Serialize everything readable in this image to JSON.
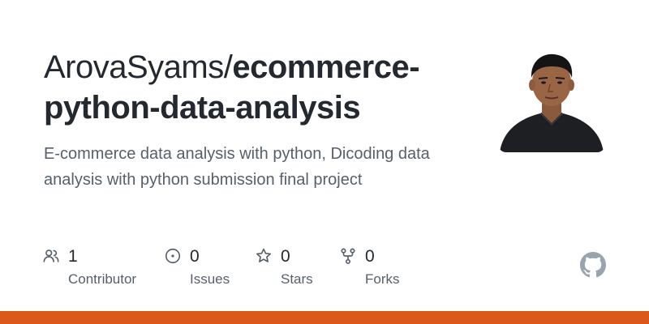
{
  "repo": {
    "owner": "ArovaSyams/",
    "name": "ecommerce-python-data-analysis",
    "description": "E-commerce data analysis with python, Dicoding data analysis with python submission final project"
  },
  "stats": [
    {
      "icon": "people-icon",
      "value": "1",
      "label": "Contributor"
    },
    {
      "icon": "issue-icon",
      "value": "0",
      "label": "Issues"
    },
    {
      "icon": "star-icon",
      "value": "0",
      "label": "Stars"
    },
    {
      "icon": "fork-icon",
      "value": "0",
      "label": "Forks"
    }
  ],
  "colors": {
    "title": "#24292f",
    "muted": "#57606a",
    "language_bar": "#d9581a",
    "icon": "#57606a",
    "github_logo": "#9aa4af"
  },
  "logo": "github-mark-icon",
  "avatar": "owner-avatar"
}
